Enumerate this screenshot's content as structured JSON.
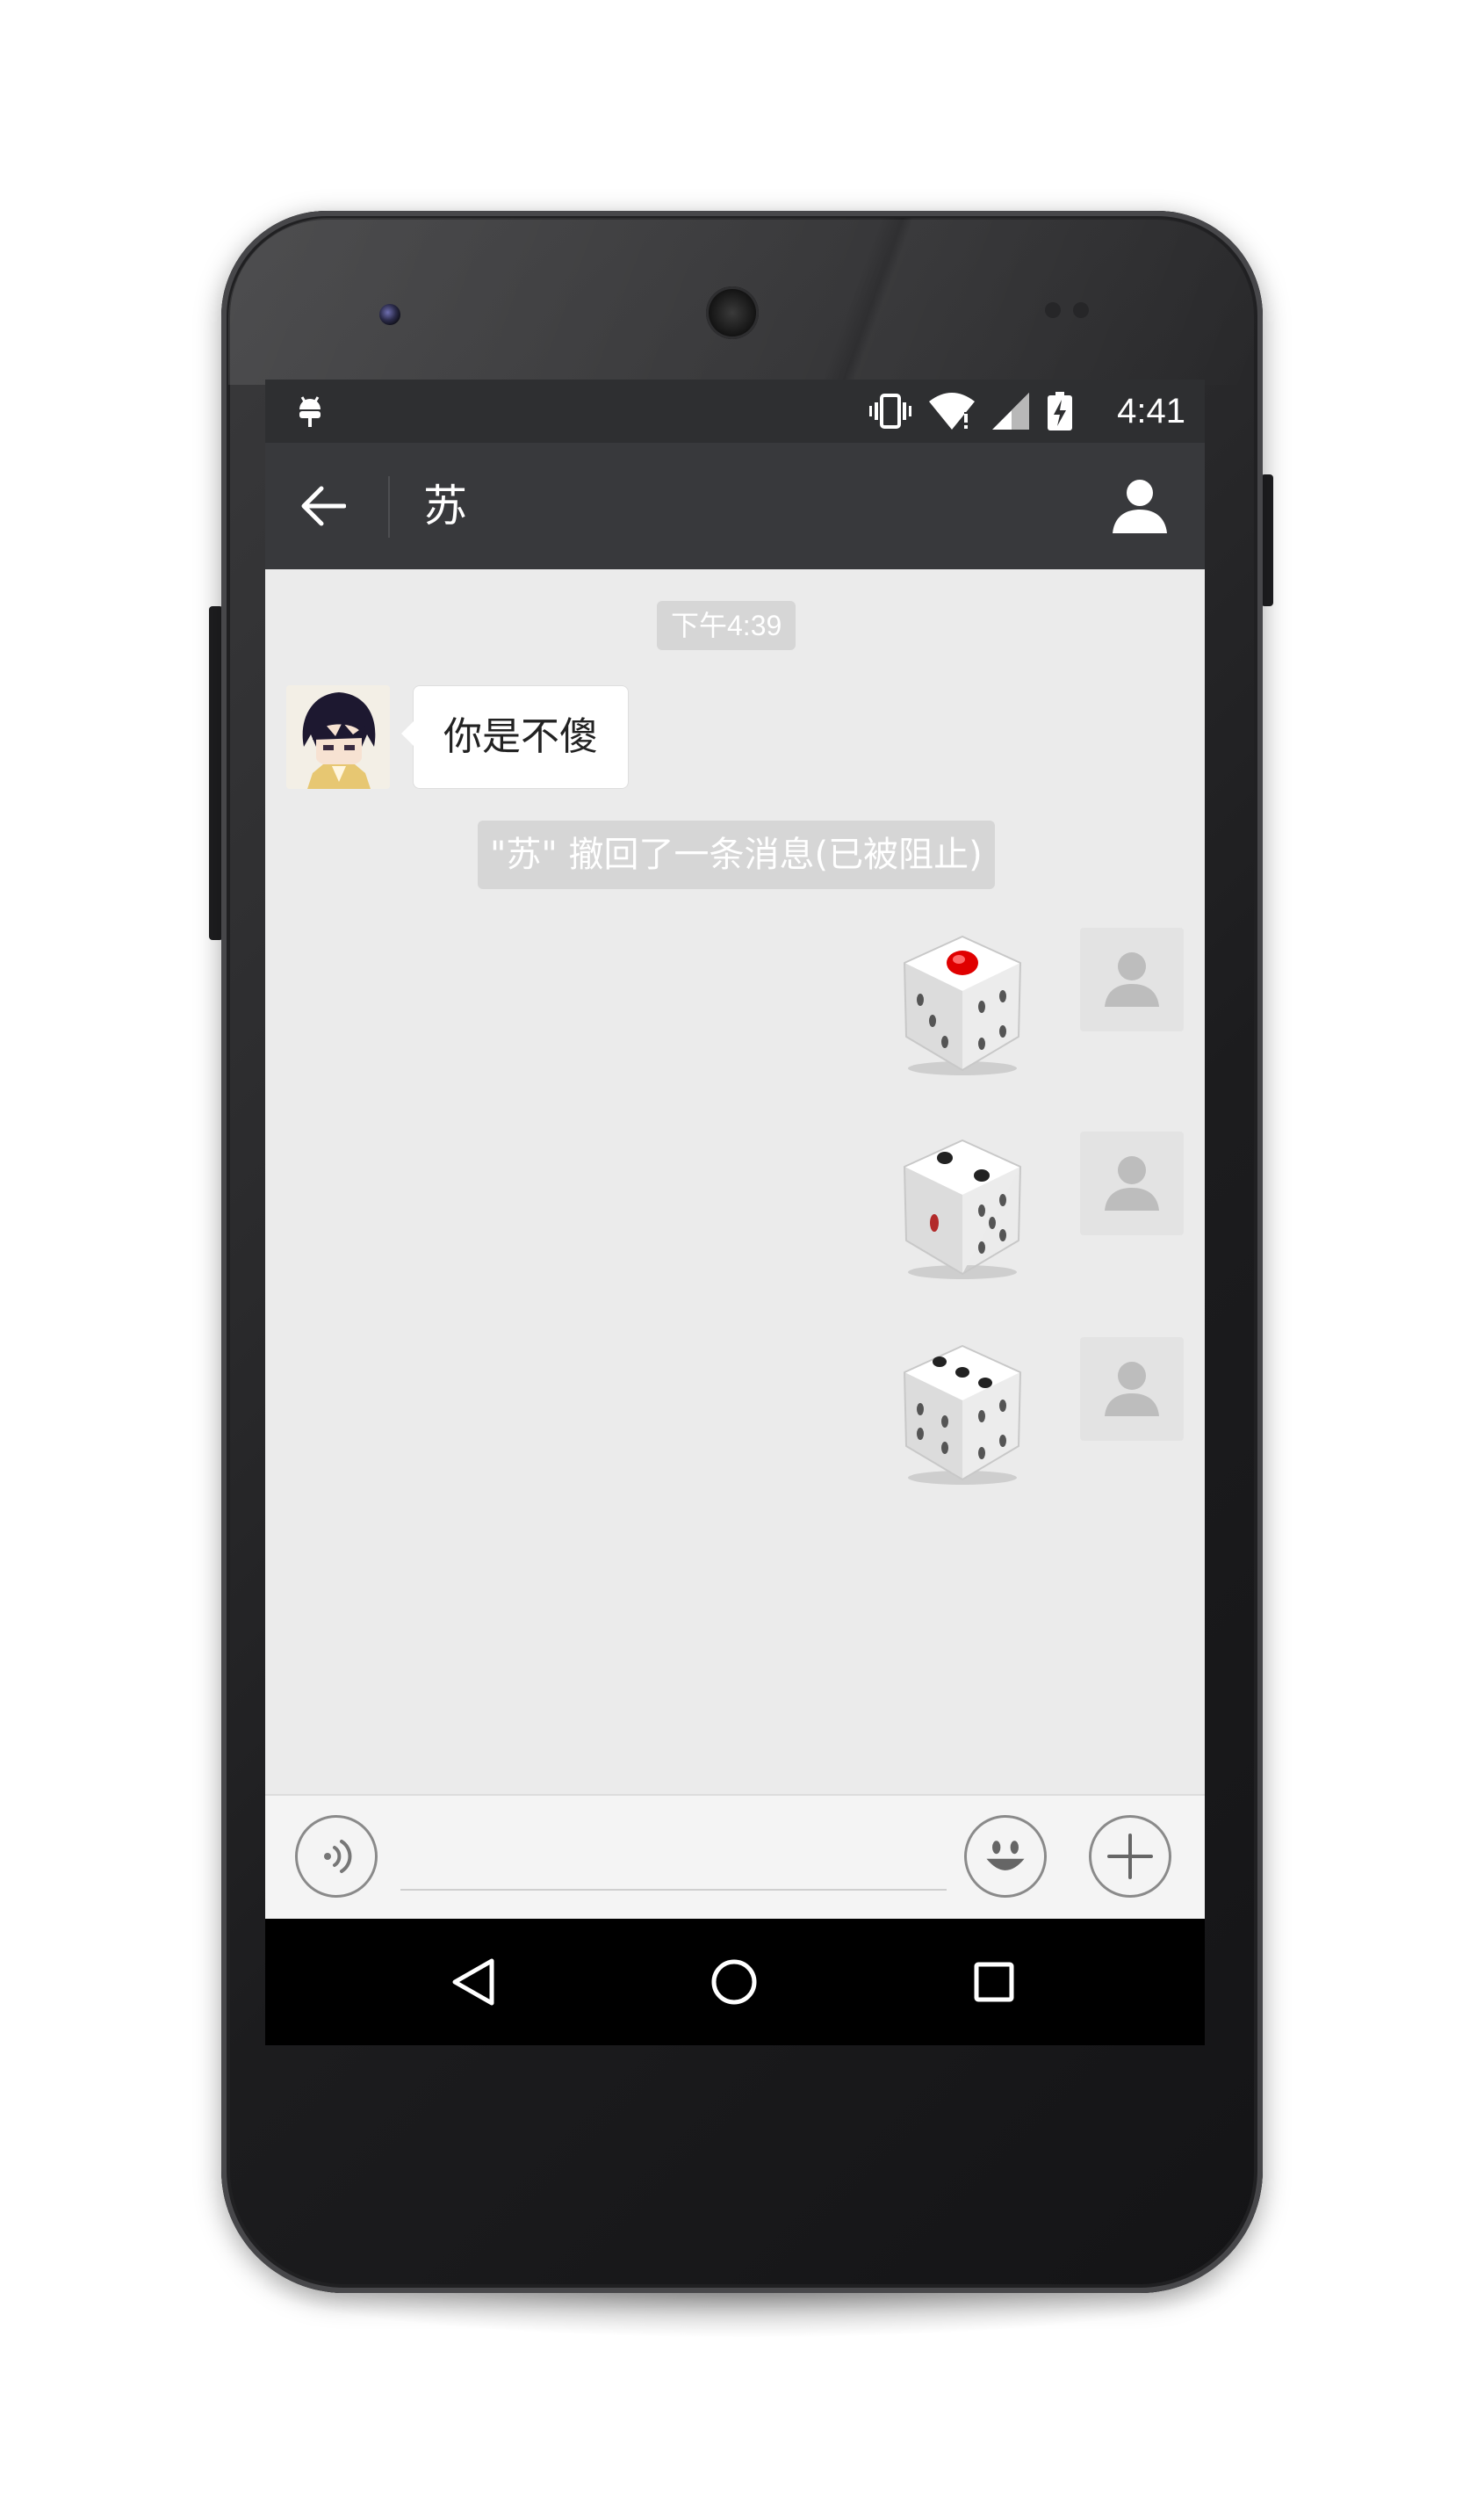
{
  "status_bar": {
    "time": "4:41",
    "icons": [
      "android-debug-icon",
      "vibrate-icon",
      "wifi-icon",
      "signal-icon",
      "battery-charging-icon"
    ]
  },
  "action_bar": {
    "back_icon": "arrow-left-icon",
    "title": "苏",
    "profile_icon": "person-icon"
  },
  "chat": {
    "timestamp": "下午4:39",
    "incoming_message": {
      "text": "你是不傻",
      "avatar": "anime-character-avatar"
    },
    "system_notice": "\"苏\" 撤回了一条消息(已被阻止)",
    "outgoing_messages": [
      {
        "type": "dice",
        "value": 1,
        "avatar": "default-person-avatar"
      },
      {
        "type": "dice",
        "value": 2,
        "avatar": "default-person-avatar"
      },
      {
        "type": "dice",
        "value": 3,
        "avatar": "default-person-avatar"
      }
    ]
  },
  "input_bar": {
    "voice_icon": "voice-input-icon",
    "text_value": "",
    "emoji_icon": "emoji-smile-icon",
    "plus_icon": "plus-icon"
  },
  "nav_bar": {
    "buttons": [
      "back-triangle-icon",
      "home-circle-icon",
      "recents-square-icon"
    ]
  },
  "colors": {
    "status_bar": "#2e2f31",
    "action_bar": "#38393c",
    "chat_background": "#ebebeb",
    "pill_background": "#d6d6d6",
    "dice_pip_red": "#e00000"
  }
}
